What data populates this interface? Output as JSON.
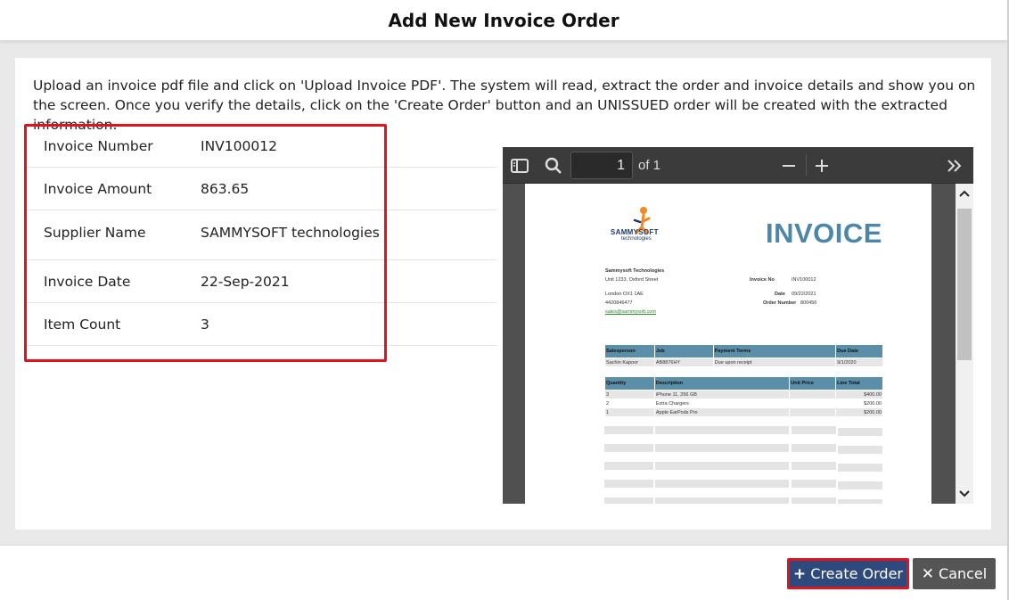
{
  "dialog": {
    "title": "Add New Invoice Order",
    "instructions": "Upload an invoice pdf file and click on 'Upload Invoice PDF'. The system will read, extract the order and invoice details and show you on the screen. Once you verify the details, click on the 'Create Order' button and an UNISSUED order will be created with the extracted information."
  },
  "details": [
    {
      "label": "Invoice Number",
      "value": "INV100012"
    },
    {
      "label": "Invoice Amount",
      "value": "863.65"
    },
    {
      "label": "Supplier Name",
      "value": "SAMMYSOFT technologies"
    },
    {
      "label": "Invoice Date",
      "value": "22-Sep-2021"
    },
    {
      "label": "Item Count",
      "value": "3"
    }
  ],
  "viewer": {
    "page_value": "1",
    "of_text": "of 1",
    "icons": {
      "sidebar": "sidebar-toggle-icon",
      "search": "search-icon",
      "zoom_out": "minus-icon",
      "zoom_in": "plus-icon",
      "more": "double-chevron-right-icon"
    }
  },
  "invoice": {
    "logo_text": "SAMMYSOFT",
    "logo_sub": "technologies",
    "title": "INVOICE",
    "company": "Sammysoft Technologies",
    "address1": "Unit 1233, Oxford Street",
    "address2": "London OX1 1AE",
    "phone": "4420846477",
    "email": "sales@sammysoft.com",
    "invoice_no_label": "Invoice No",
    "invoice_no": "INV100012",
    "date_label": "Date",
    "date": "09/22/2021",
    "order_label": "Order Number",
    "order": "800456",
    "table1": {
      "headers": [
        "Salesperson",
        "Job",
        "Payment Terms",
        "Due Date"
      ],
      "row": [
        "Sachin Kapoor",
        "AB8876HY",
        "Due upon receipt",
        "9/1/2020"
      ]
    },
    "table2": {
      "headers": [
        "Quantity",
        "Description",
        "Unit Price",
        "Line Total"
      ],
      "rows": [
        [
          "3",
          "iPhone 11, 256 GB",
          "",
          "$400.00"
        ],
        [
          "2",
          "Extra Chargers",
          "",
          "$200.00"
        ],
        [
          "1",
          "Apple EarPods Pro",
          "",
          "$200.00"
        ]
      ]
    }
  },
  "footer": {
    "create_label": "Create Order",
    "cancel_label": "Cancel",
    "create_icon": "plus-icon",
    "cancel_icon": "close-icon"
  },
  "colors": {
    "primary": "#2e4a7d",
    "highlight": "#e0141e",
    "cancel": "#555555",
    "invoice_accent": "#4c87a8"
  }
}
